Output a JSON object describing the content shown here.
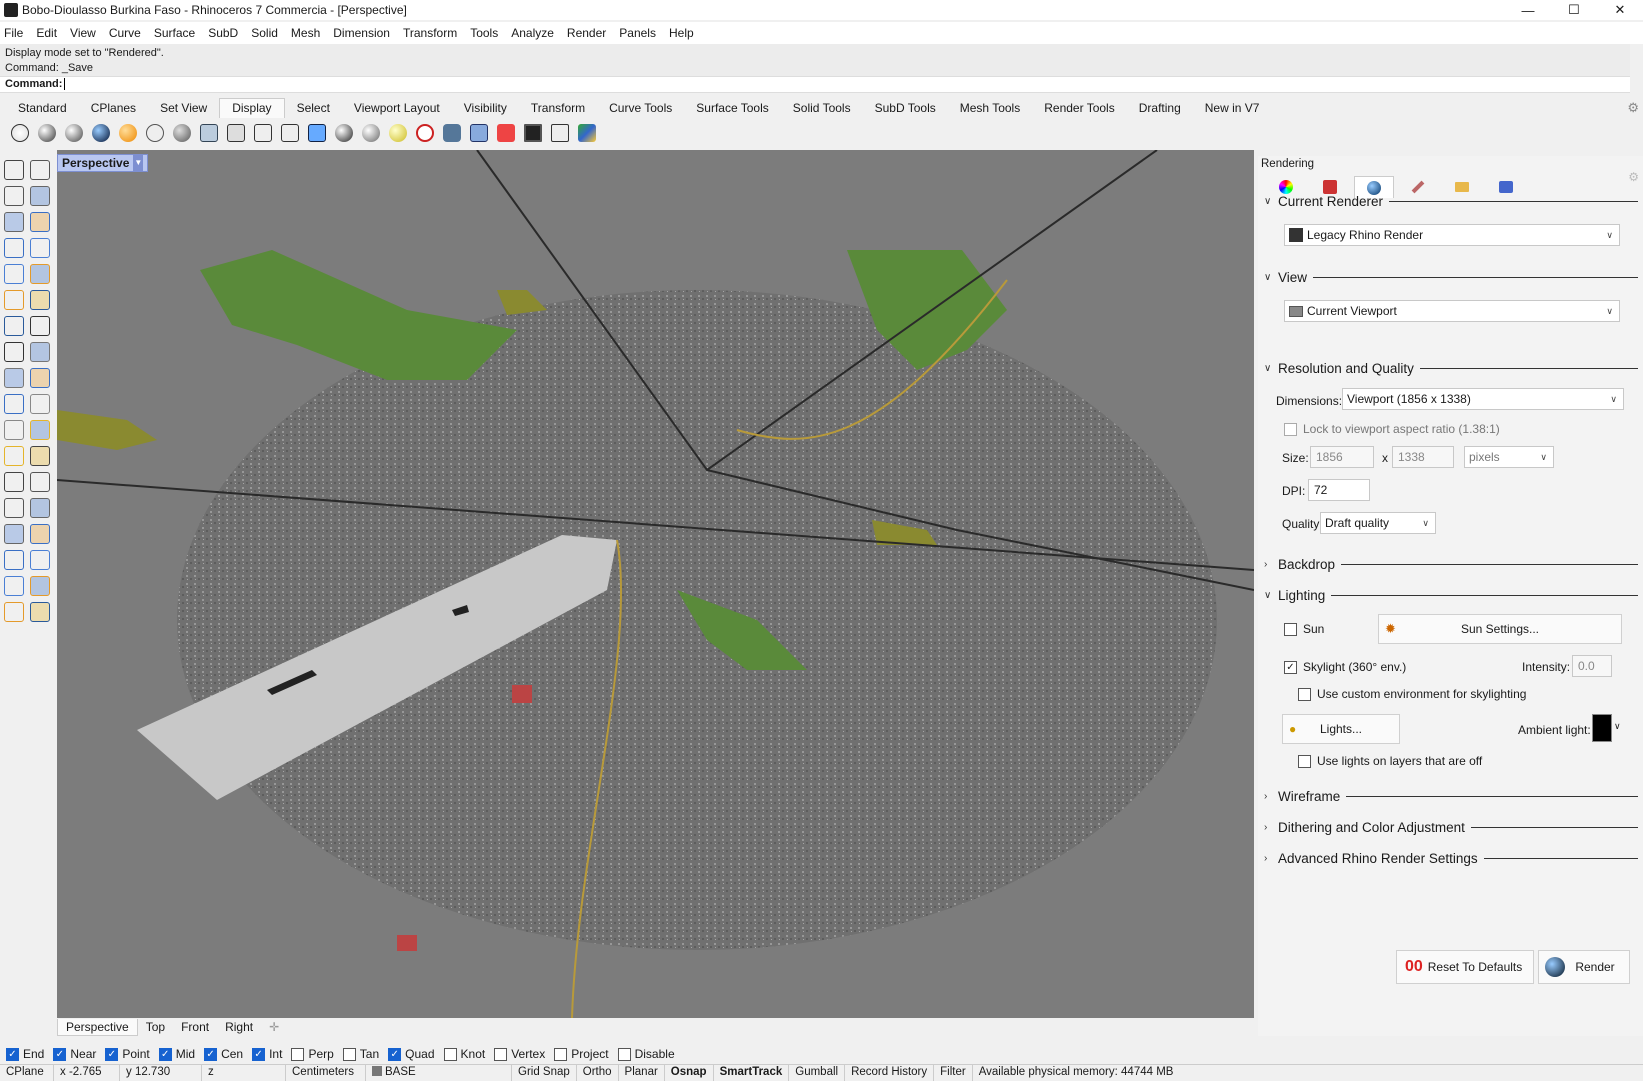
{
  "window": {
    "title": "Bobo-Dioulasso Burkina Faso - Rhinoceros 7 Commercia - [Perspective]",
    "minimize": "—",
    "maximize": "☐",
    "close": "✕"
  },
  "menu": [
    "File",
    "Edit",
    "View",
    "Curve",
    "Surface",
    "SubD",
    "Solid",
    "Mesh",
    "Dimension",
    "Transform",
    "Tools",
    "Analyze",
    "Render",
    "Panels",
    "Help"
  ],
  "command": {
    "history_line1": "Display mode set to \"Rendered\".",
    "history_line2": "Command: _Save",
    "prompt": "Command:"
  },
  "toolbar_tabs": [
    "Standard",
    "CPlanes",
    "Set View",
    "Display",
    "Select",
    "Viewport Layout",
    "Visibility",
    "Transform",
    "Curve Tools",
    "Surface Tools",
    "Solid Tools",
    "SubD Tools",
    "Mesh Tools",
    "Render Tools",
    "Drafting",
    "New in V7"
  ],
  "toolbar_active_tab": "Display",
  "viewport": {
    "label": "Perspective",
    "tabs": [
      "Perspective",
      "Top",
      "Front",
      "Right"
    ],
    "add_tab": "✛"
  },
  "osnaps": [
    {
      "label": "End",
      "on": true
    },
    {
      "label": "Near",
      "on": true
    },
    {
      "label": "Point",
      "on": true
    },
    {
      "label": "Mid",
      "on": true
    },
    {
      "label": "Cen",
      "on": true
    },
    {
      "label": "Int",
      "on": true
    },
    {
      "label": "Perp",
      "on": false
    },
    {
      "label": "Tan",
      "on": false
    },
    {
      "label": "Quad",
      "on": true
    },
    {
      "label": "Knot",
      "on": false
    },
    {
      "label": "Vertex",
      "on": false
    },
    {
      "label": "Project",
      "on": false
    },
    {
      "label": "Disable",
      "on": false
    }
  ],
  "status": {
    "cplane": "CPlane",
    "x": "x -2.765",
    "y": "y 12.730",
    "z": "z",
    "units": "Centimeters",
    "layer": "BASE",
    "grid_snap": "Grid Snap",
    "ortho": "Ortho",
    "planar": "Planar",
    "osnap": "Osnap",
    "smarttrack": "SmartTrack",
    "gumball": "Gumball",
    "record_history": "Record History",
    "filter": "Filter",
    "memory": "Available physical memory: 44744 MB"
  },
  "panel": {
    "title": "Rendering",
    "current_renderer": {
      "heading": "Current Renderer",
      "value": "Legacy Rhino Render"
    },
    "view": {
      "heading": "View",
      "value": "Current Viewport"
    },
    "resolution": {
      "heading": "Resolution and Quality",
      "dimensions_label": "Dimensions:",
      "dimensions_value": "Viewport (1856 x 1338)",
      "lock_label": "Lock to viewport aspect ratio (1.38:1)",
      "size_label": "Size:",
      "width": "1856",
      "times": "x",
      "height": "1338",
      "units": "pixels",
      "dpi_label": "DPI:",
      "dpi": "72",
      "quality_label": "Quality:",
      "quality": "Draft quality"
    },
    "backdrop": "Backdrop",
    "lighting": {
      "heading": "Lighting",
      "sun_label": "Sun",
      "sun_settings": "Sun Settings...",
      "skylight_label": "Skylight (360° env.)",
      "intensity_label": "Intensity:",
      "intensity": "0.0",
      "custom_env_label": "Use custom environment for skylighting",
      "lights_button": "Lights...",
      "ambient_label": "Ambient light:",
      "use_lights_off_label": "Use lights on layers that are off"
    },
    "wireframe": "Wireframe",
    "dithering": "Dithering and Color Adjustment",
    "advanced": "Advanced Rhino Render Settings",
    "reset_button": "Reset To Defaults",
    "render_button": "Render"
  }
}
